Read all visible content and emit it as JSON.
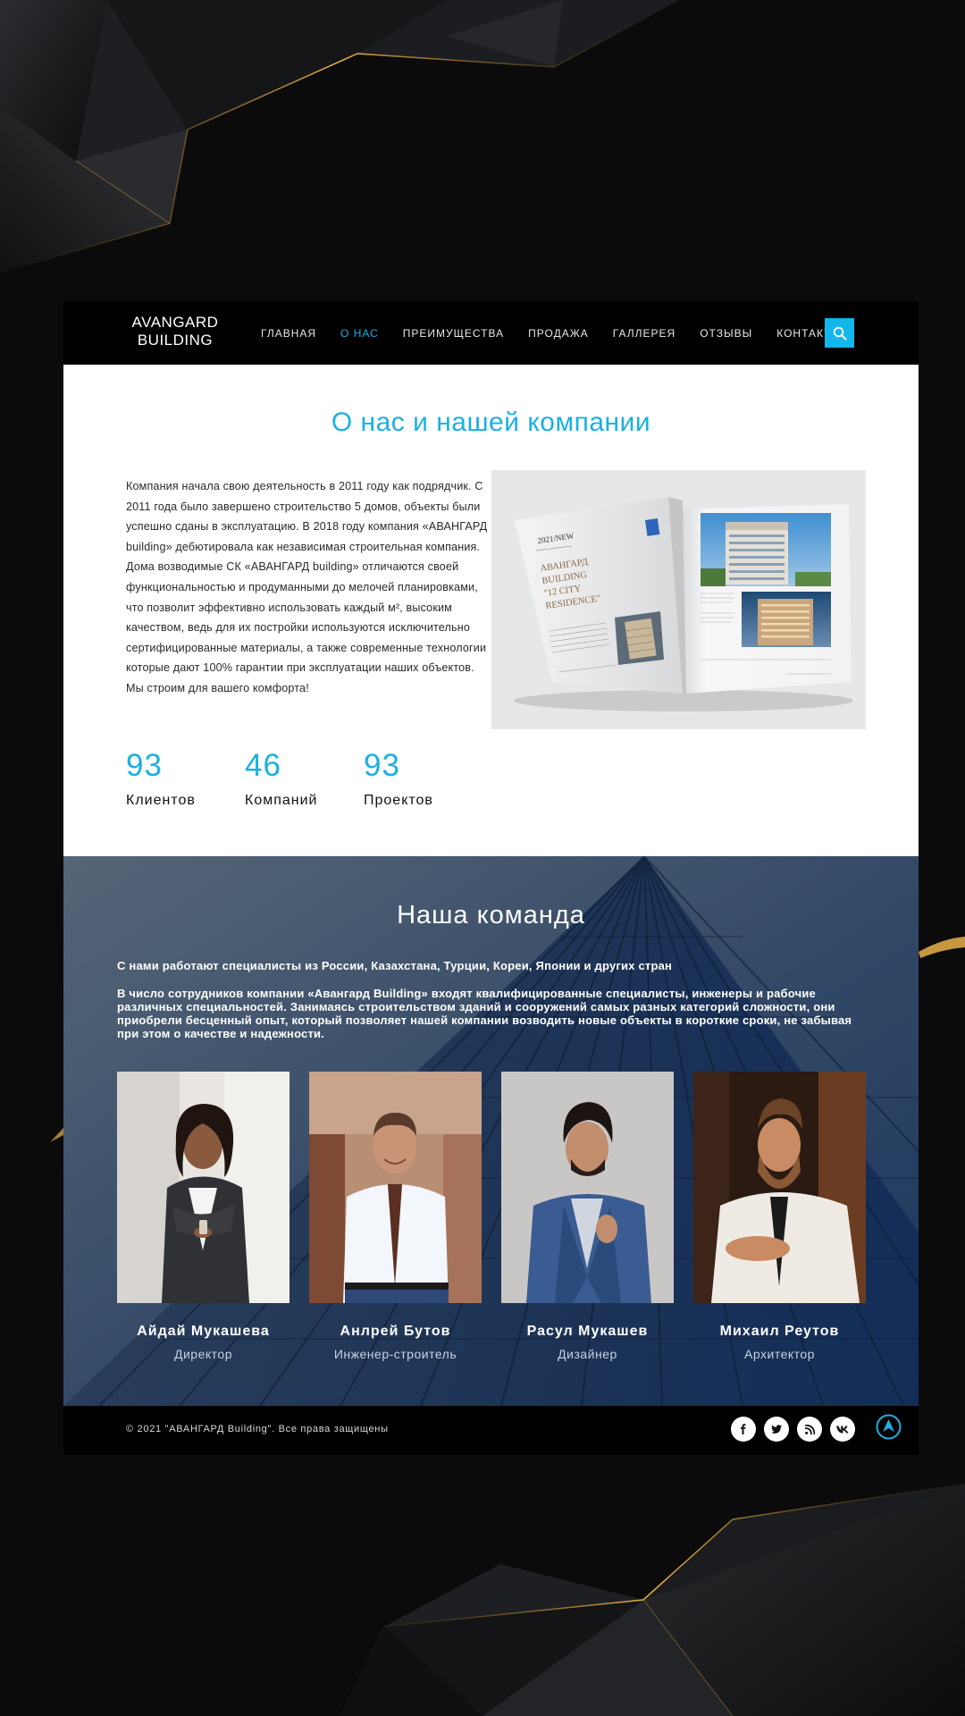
{
  "brand": {
    "line1": "AVANGARD",
    "line2": "BUILDING"
  },
  "nav": {
    "items": [
      {
        "label": "ГЛАВНАЯ"
      },
      {
        "label": "О НАС"
      },
      {
        "label": "ПРЕИМУЩЕСТВА"
      },
      {
        "label": "ПРОДАЖА"
      },
      {
        "label": "ГАЛЛЕРЕЯ"
      },
      {
        "label": "ОТЗЫВЫ"
      },
      {
        "label": "КОНТАКТЫ"
      }
    ],
    "active_label": "О НАС"
  },
  "about": {
    "title": "О нас и нашей компании",
    "text": "Компания начала свою деятельность в 2011 году как подрядчик. С 2011 года было завершено строительство 5 домов, объекты были успешно сданы в эксплуатацию. В 2018 году компания «АВАНГАРД building» дебютировала как независимая строительная компания. Дома возводимые СК «АВАНГАРД building» отличаются своей функциональностью и продуманными до мелочей планировками, что позволит эффективно использовать каждый м², высоким качеством, ведь для их постройки используются исключительно сертифицированные материалы, а также современные технологии которые дают 100% гарантии при эксплуатации наших объектов. Мы строим для вашего комфорта!",
    "brochure": {
      "tag": "2021/NEW",
      "title_line1": "АВАНГАРД",
      "title_line2": "BUILDING",
      "title_line3": "\"12 CITY",
      "title_line4": "RESIDENCE\""
    },
    "stats": [
      {
        "value": "93",
        "label": "Клиентов"
      },
      {
        "value": "46",
        "label": "Компаний"
      },
      {
        "value": "93",
        "label": "Проектов"
      }
    ]
  },
  "team": {
    "title": "Наша команда",
    "subtitle": "С нами работают специалисты из России, Казахстана, Турции, Кореи, Японии и других стран",
    "description": "В число сотрудников компании «Авангард Building» входят квалифицированные специалисты, инженеры и рабочие различных специальностей. Занимаясь строительством зданий и сооружений самых разных категорий сложности, они приобрели бесценный опыт, который позволяет нашей компании возводить новые объекты в короткие сроки, не забывая при этом о качестве и надежности.",
    "members": [
      {
        "name": "Айдай Мукашева",
        "role": "Директор"
      },
      {
        "name": "Анлрей Бутов",
        "role": "Инженер-строитель"
      },
      {
        "name": "Расул Мукашев",
        "role": "Дизайнер"
      },
      {
        "name": "Михаил Реутов",
        "role": "Архитектор"
      }
    ]
  },
  "footer": {
    "copyright": "© 2021 \"АВАНГАРД Building\". Все права защищены",
    "socials": [
      {
        "icon": "facebook-icon",
        "glyph": "f"
      },
      {
        "icon": "twitter-icon",
        "glyph": "t"
      },
      {
        "icon": "rss-icon",
        "glyph": "rss"
      },
      {
        "icon": "vk-icon",
        "glyph": "vk"
      }
    ]
  },
  "colors": {
    "accent": "#1ab0e3",
    "header": "#000000",
    "background": "#0b0b0c",
    "gold": "#e7b04a"
  }
}
